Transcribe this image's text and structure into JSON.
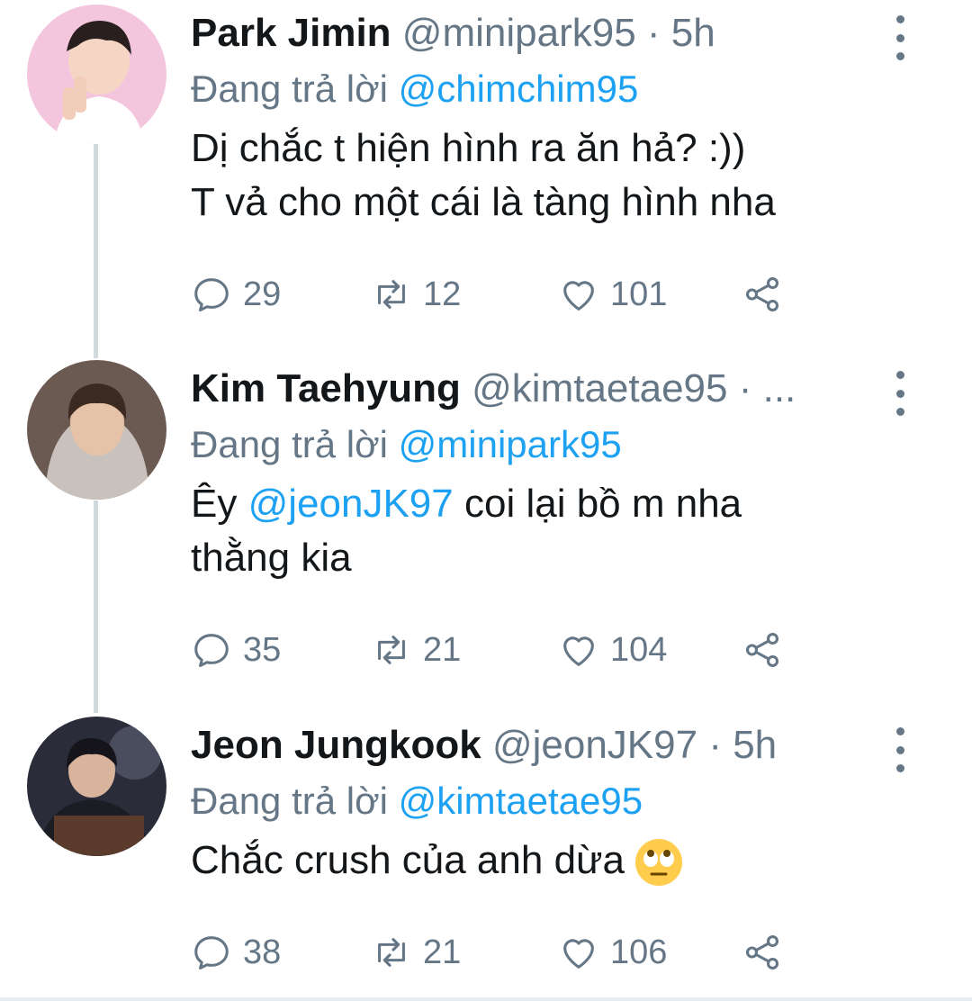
{
  "tweets": [
    {
      "display_name": "Park Jimin",
      "handle_time": "@minipark95 · 5h",
      "reply_prefix": "Đang trả lời",
      "reply_to": "@chimchim95",
      "text_line1": "Dị chắc t hiện hình ra ăn hả? :))",
      "text_line2": "T vả cho một cái là tàng hình nha",
      "replies": "29",
      "retweets": "12",
      "likes": "101"
    },
    {
      "display_name": "Kim Taehyung",
      "handle_time": "@kimtaetae95 · ...",
      "reply_prefix": "Đang trả lời",
      "reply_to": "@minipark95",
      "text_prefix": "Êy",
      "text_mention": "@jeonJK97",
      "text_suffix": "coi lại bồ m nha",
      "text_line2": "thằng kia",
      "replies": "35",
      "retweets": "21",
      "likes": "104"
    },
    {
      "display_name": "Jeon Jungkook",
      "handle_time": "@jeonJK97 · 5h",
      "reply_prefix": "Đang trả lời",
      "reply_to": "@kimtaetae95",
      "text_line1": "Chắc crush của anh dừa",
      "emoji": "face-with-rolling-eyes",
      "replies": "38",
      "retweets": "21",
      "likes": "106"
    }
  ],
  "icons": {
    "reply": "reply-icon",
    "retweet": "retweet-icon",
    "like": "heart-icon",
    "share": "share-icon",
    "more": "more-vertical-icon"
  },
  "colors": {
    "mention": "#1da1f2",
    "secondary": "#657786",
    "thread_line": "#cfd9de"
  }
}
